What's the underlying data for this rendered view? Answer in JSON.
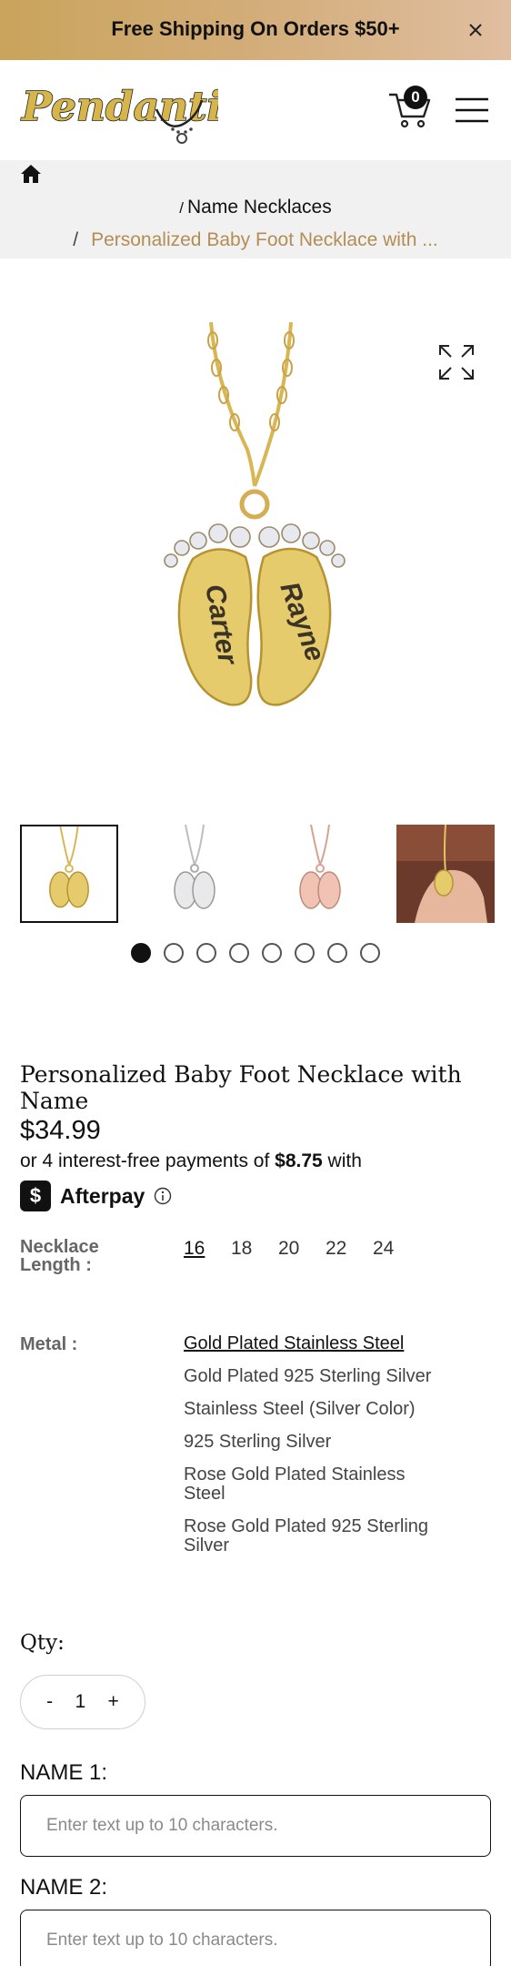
{
  "announcement": {
    "text": "Free Shipping On Orders $50+"
  },
  "header": {
    "logo_text": "Pendantify",
    "cart_count": "0"
  },
  "breadcrumb": {
    "separator": "/",
    "items": [
      "Name Necklaces",
      "Personalized Baby Foot Necklace with ..."
    ]
  },
  "gallery": {
    "engraved_names": [
      "Carter",
      "Rayne"
    ],
    "thumbnails": [
      "gold",
      "silver",
      "rose-gold",
      "worn-on-hand"
    ],
    "dot_count": 8,
    "active_dot": 1
  },
  "product": {
    "title": "Personalized Baby Foot Necklace with Name",
    "price": "$34.99",
    "installments_prefix": "or 4 interest-free payments of ",
    "installment_amount": "$8.75",
    "installments_suffix": " with",
    "afterpay_label": "Afterpay",
    "afterpay_badge": "$"
  },
  "options": {
    "length_label": "Necklace Length :",
    "lengths": [
      "16",
      "18",
      "20",
      "22",
      "24"
    ],
    "selected_length": "16",
    "metal_label": "Metal :",
    "metals": [
      "Gold Plated Stainless Steel",
      "Gold Plated 925 Sterling Silver",
      "Stainless Steel (Silver Color)",
      "925 Sterling Silver",
      "Rose Gold Plated Stainless Steel",
      "Rose Gold Plated 925 Sterling Silver"
    ],
    "selected_metal": "Gold Plated Stainless Steel"
  },
  "quantity": {
    "label": "Qty:",
    "minus": "-",
    "value": "1",
    "plus": "+"
  },
  "fields": [
    {
      "label": "NAME 1:",
      "placeholder": "Enter text up to 10 characters."
    },
    {
      "label": "NAME 2:",
      "placeholder": "Enter text up to 10 characters."
    }
  ],
  "colors": {
    "announcement_start": "#c9a45c",
    "announcement_end": "#e0bea0",
    "breadcrumb_active": "#b38d54",
    "breadcrumb_bg": "#f1f1f1"
  }
}
